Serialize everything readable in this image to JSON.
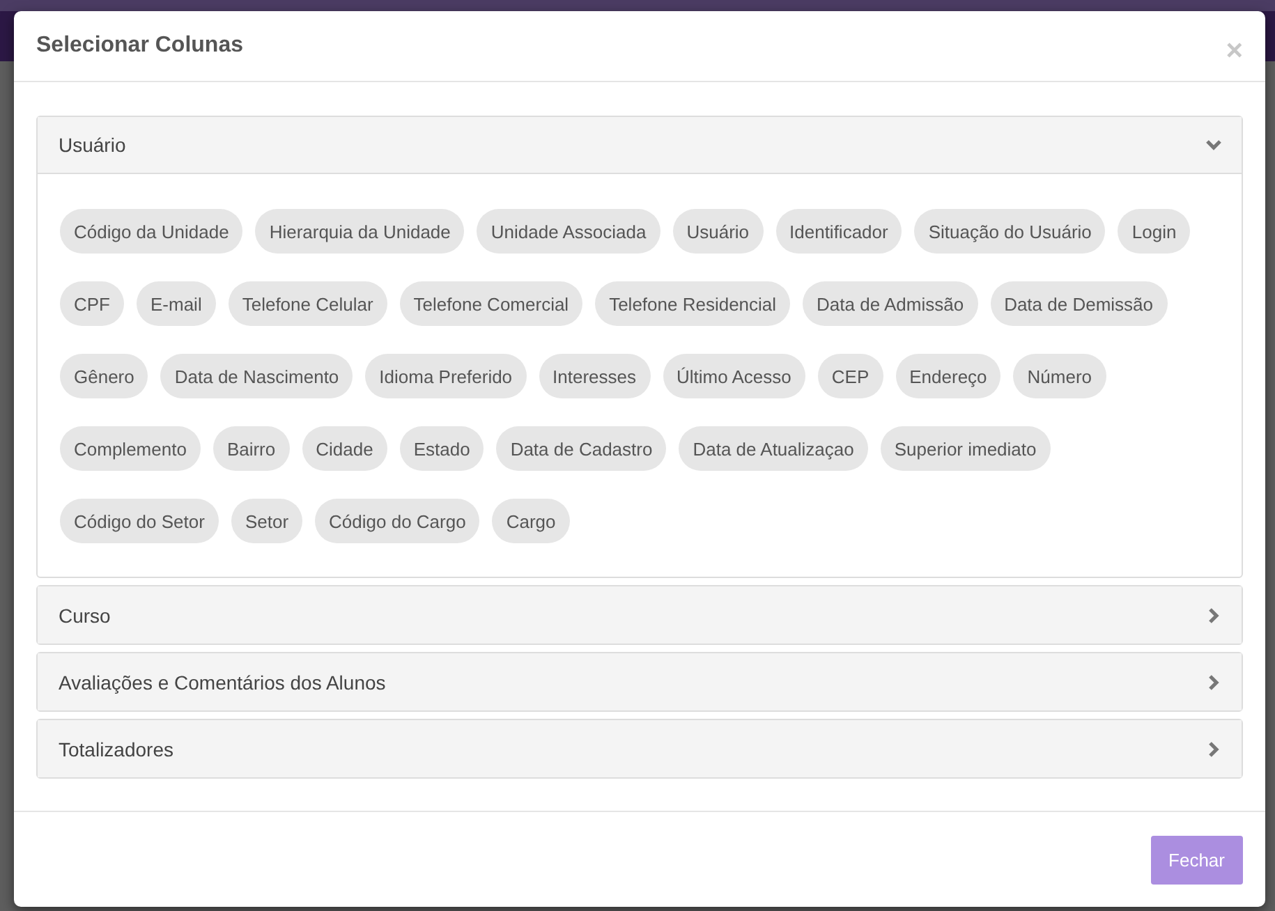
{
  "modal": {
    "title": "Selecionar Colunas",
    "close": "×"
  },
  "panels": [
    {
      "title": "Usuário",
      "expanded": true,
      "chips": [
        "Código da Unidade",
        "Hierarquia da Unidade",
        "Unidade Associada",
        "Usuário",
        "Identificador",
        "Situação do Usuário",
        "Login",
        "CPF",
        "E-mail",
        "Telefone Celular",
        "Telefone Comercial",
        "Telefone Residencial",
        "Data de Admissão",
        "Data de Demissão",
        "Gênero",
        "Data de Nascimento",
        "Idioma Preferido",
        "Interesses",
        "Último Acesso",
        "CEP",
        "Endereço",
        "Número",
        "Complemento",
        "Bairro",
        "Cidade",
        "Estado",
        "Data de Cadastro",
        "Data de Atualizaçao",
        "Superior imediato",
        "Código do Setor",
        "Setor",
        "Código do Cargo",
        "Cargo"
      ]
    },
    {
      "title": "Curso",
      "expanded": false
    },
    {
      "title": "Avaliações e Comentários dos Alunos",
      "expanded": false
    },
    {
      "title": "Totalizadores",
      "expanded": false
    }
  ],
  "footer": {
    "button": "Fechar"
  }
}
